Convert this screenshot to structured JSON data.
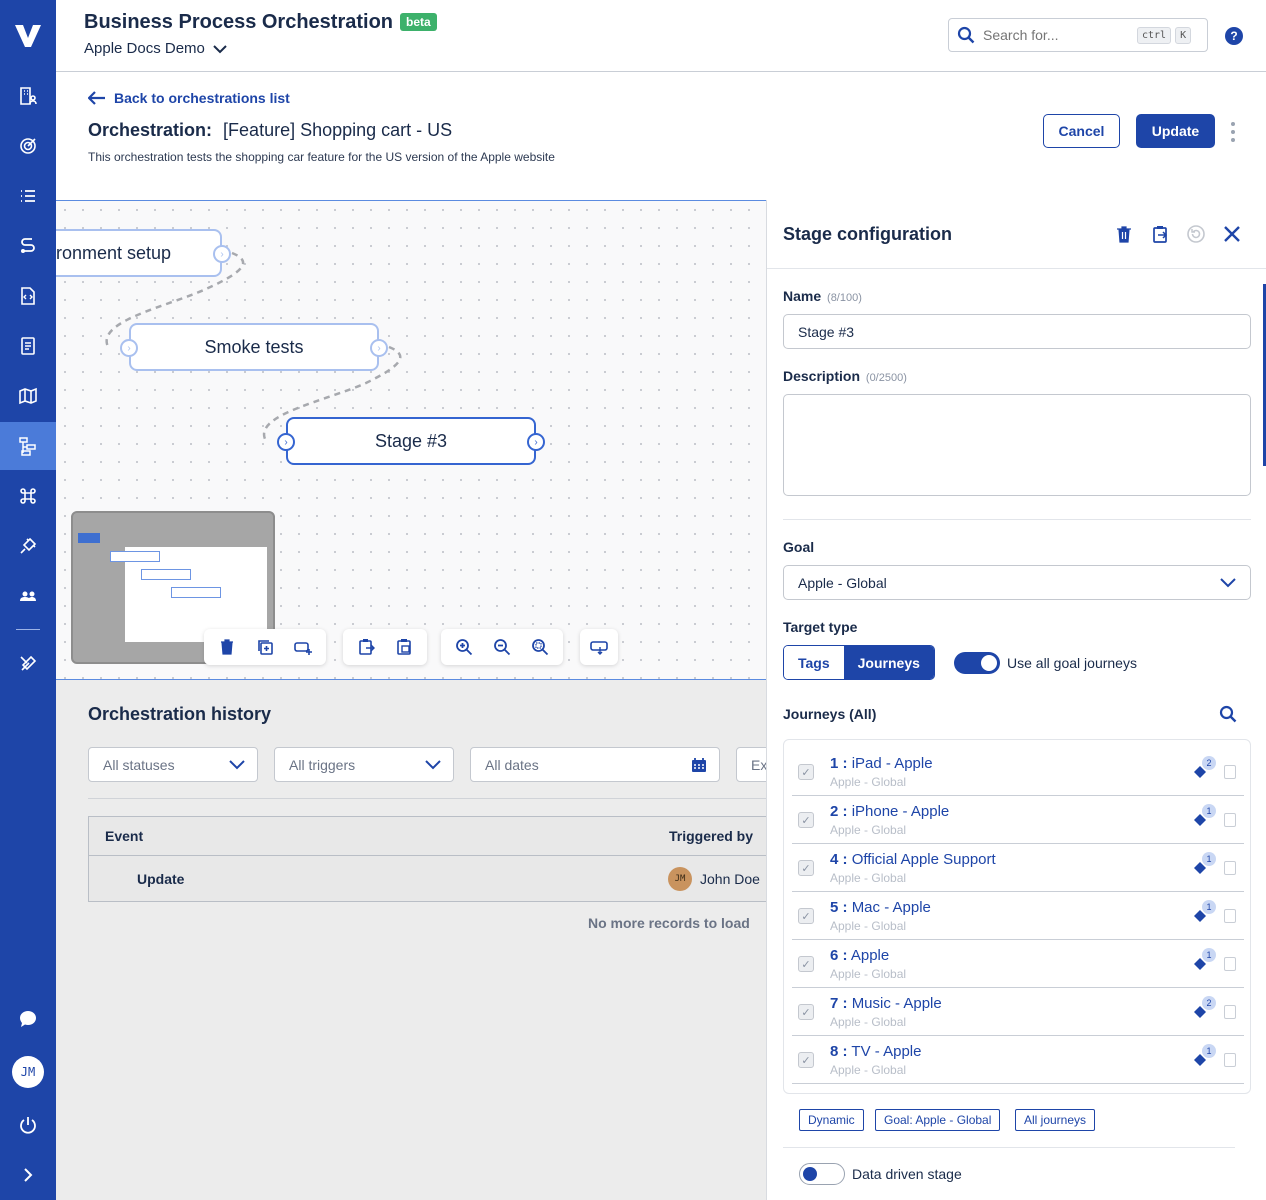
{
  "header": {
    "title": "Business Process Orchestration",
    "badge": "beta",
    "workspace": "Apple Docs Demo",
    "search_placeholder": "Search for...",
    "shortcut_ctrl": "ctrl",
    "shortcut_key": "K",
    "help": "?"
  },
  "sidebar": {
    "items": [
      {
        "icon": "building-user-icon"
      },
      {
        "icon": "target-icon"
      },
      {
        "icon": "list-icon"
      },
      {
        "icon": "route-icon"
      },
      {
        "icon": "code-file-icon"
      },
      {
        "icon": "checklist-icon"
      },
      {
        "icon": "map-icon"
      },
      {
        "icon": "orchestration-icon",
        "active": true
      },
      {
        "icon": "command-icon"
      },
      {
        "icon": "plug-icon"
      },
      {
        "icon": "users-icon"
      },
      {
        "icon": "tools-icon"
      }
    ],
    "bottom": [
      {
        "icon": "chat-icon"
      },
      {
        "avatar": "JM"
      },
      {
        "icon": "power-icon"
      },
      {
        "icon": "chevron-right-icon"
      }
    ]
  },
  "orchestration": {
    "back_label": "Back to orchestrations list",
    "title_prefix": "Orchestration:",
    "title": "[Feature] Shopping cart - US",
    "description": "This orchestration tests the shopping car feature for the US version of the Apple website",
    "cancel_label": "Cancel",
    "update_label": "Update"
  },
  "canvas": {
    "nodes": [
      {
        "label": "ronment setup"
      },
      {
        "label": "Smoke tests"
      },
      {
        "label": "Stage #3",
        "selected": true
      }
    ]
  },
  "history": {
    "title": "Orchestration history",
    "filters": {
      "statuses": "All statuses",
      "triggers": "All triggers",
      "dates": "All dates",
      "extra": "Ex"
    },
    "columns": {
      "event": "Event",
      "triggered_by": "Triggered by"
    },
    "rows": [
      {
        "event": "Update",
        "avatar": "JM",
        "user": "John Doe"
      }
    ],
    "no_more": "No more records to load"
  },
  "panel": {
    "title": "Stage configuration",
    "name_label": "Name",
    "name_count": "(8/100)",
    "name_value": "Stage #3",
    "description_label": "Description",
    "description_count": "(0/2500)",
    "goal_label": "Goal",
    "goal_value": "Apple - Global",
    "target_type_label": "Target type",
    "target_tags": "Tags",
    "target_journeys": "Journeys",
    "use_all_label": "Use all goal journeys",
    "journeys_label": "Journeys (All)",
    "journeys": [
      {
        "id": "1 :",
        "name": "iPad - Apple",
        "goal": "Apple - Global",
        "count": "2"
      },
      {
        "id": "2 :",
        "name": "iPhone - Apple",
        "goal": "Apple - Global",
        "count": "1"
      },
      {
        "id": "4 :",
        "name": "Official Apple Support",
        "goal": "Apple - Global",
        "count": "1"
      },
      {
        "id": "5 :",
        "name": "Mac - Apple",
        "goal": "Apple - Global",
        "count": "1"
      },
      {
        "id": "6 :",
        "name": "Apple",
        "goal": "Apple - Global",
        "count": "1"
      },
      {
        "id": "7 :",
        "name": "Music - Apple",
        "goal": "Apple - Global",
        "count": "2"
      },
      {
        "id": "8 :",
        "name": "TV - Apple",
        "goal": "Apple - Global",
        "count": "1"
      }
    ],
    "tags": [
      "Dynamic",
      "Goal: Apple - Global",
      "All journeys"
    ],
    "data_driven_label": "Data driven stage"
  },
  "colors": {
    "primary": "#1e45a8",
    "sidebar_active": "#4b7bd9",
    "beta": "#3db16b"
  }
}
